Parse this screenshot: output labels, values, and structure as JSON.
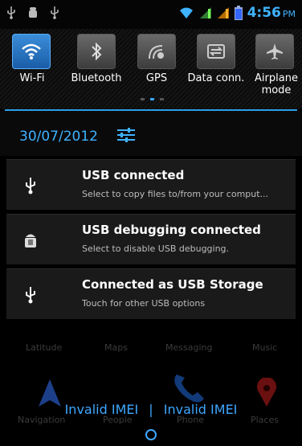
{
  "status_bar": {
    "time": "4:56",
    "ampm": "PM",
    "icons": [
      "usb-icon",
      "android-debug-icon",
      "usb-icon",
      "wifi-icon",
      "signal-icon",
      "signal-icon",
      "battery-icon"
    ]
  },
  "quick_settings": {
    "tiles": [
      {
        "label": "Wi-Fi",
        "icon": "wifi-icon",
        "active": true
      },
      {
        "label": "Bluetooth",
        "icon": "bluetooth-icon",
        "active": false
      },
      {
        "label": "GPS",
        "icon": "gps-icon",
        "active": false
      },
      {
        "label": "Data conn.",
        "icon": "data-icon",
        "active": false
      },
      {
        "label": "Airplane mode",
        "icon": "airplane-icon",
        "active": false
      }
    ],
    "page_dots": 3,
    "active_dot": 1
  },
  "date": "30/07/2012",
  "notifications": [
    {
      "title": "USB connected",
      "subtitle": "Select to copy files to/from your comput...",
      "icon": "usb-icon"
    },
    {
      "title": "USB debugging connected",
      "subtitle": "Select to disable USB debugging.",
      "icon": "android-debug-icon"
    },
    {
      "title": "Connected as USB Storage",
      "subtitle": "Touch for other USB options",
      "icon": "usb-icon"
    }
  ],
  "background_apps": [
    {
      "label": "Latitude"
    },
    {
      "label": "Maps"
    },
    {
      "label": "Messaging"
    },
    {
      "label": "Music"
    },
    {
      "label": "Navigation"
    },
    {
      "label": "People"
    },
    {
      "label": "Phone"
    },
    {
      "label": "Places"
    }
  ],
  "carrier": {
    "sim1": "Invalid IMEI",
    "separator": "|",
    "sim2": "Invalid IMEI"
  },
  "colors": {
    "accent": "#3fb3ff",
    "panel": "#1a1a1a"
  }
}
